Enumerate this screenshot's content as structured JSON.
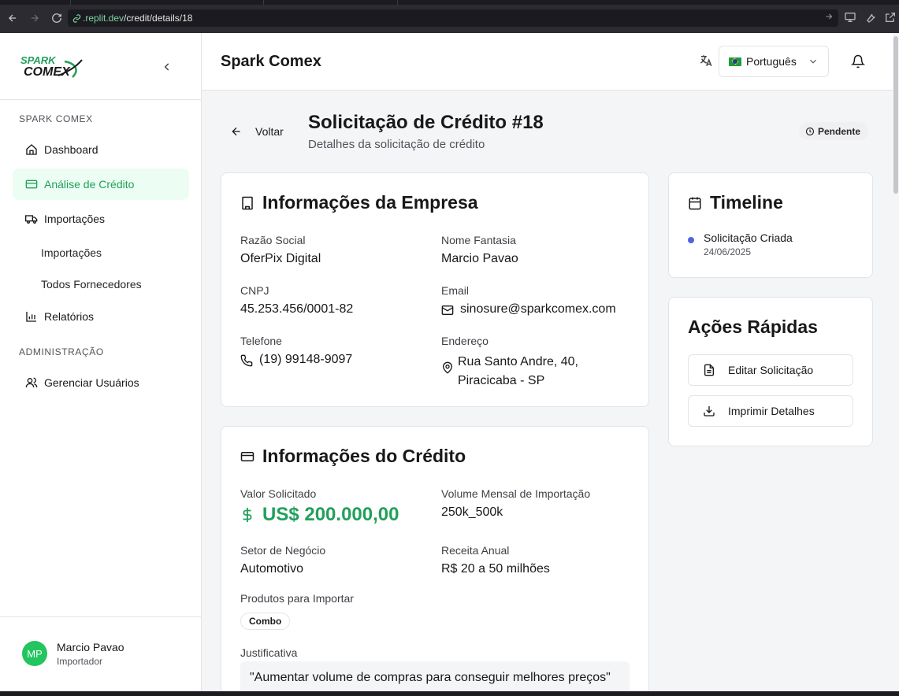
{
  "browser": {
    "url_domain": ".replit.dev",
    "url_path": "/credit/details/18"
  },
  "sidebar": {
    "logo_text_top": "SPARK",
    "logo_text_bottom": "COMEX",
    "section_main": "SPARK COMEX",
    "items": [
      {
        "label": "Dashboard",
        "icon": "home-icon"
      },
      {
        "label": "Análise de Crédito",
        "icon": "credit-card-icon",
        "active": true
      },
      {
        "label": "Importações",
        "icon": "truck-icon"
      },
      {
        "label": "Relatórios",
        "icon": "bar-chart-icon"
      }
    ],
    "subitems": [
      "Importações",
      "Todos Fornecedores"
    ],
    "section_admin": "ADMINISTRAÇÃO",
    "admin_items": [
      {
        "label": "Gerenciar Usuários",
        "icon": "users-icon"
      }
    ],
    "user": {
      "initials": "MP",
      "name": "Marcio Pavao",
      "role": "Importador"
    }
  },
  "header": {
    "title": "Spark Comex",
    "language": "Português"
  },
  "page": {
    "back_label": "Voltar",
    "title": "Solicitação de Crédito #18",
    "subtitle": "Detalhes da solicitação de crédito",
    "status": "Pendente"
  },
  "company": {
    "title": "Informações da Empresa",
    "razao_social_label": "Razão Social",
    "razao_social": "OferPix Digital",
    "nome_fantasia_label": "Nome Fantasia",
    "nome_fantasia": "Marcio Pavao",
    "cnpj_label": "CNPJ",
    "cnpj": "45.253.456/0001-82",
    "email_label": "Email",
    "email": "sinosure@sparkcomex.com",
    "telefone_label": "Telefone",
    "telefone": "(19) 99148-9097",
    "endereco_label": "Endereço",
    "endereco_line1": "Rua Santo Andre, 40,",
    "endereco_line2": "Piracicaba - SP"
  },
  "credit": {
    "title": "Informações do Crédito",
    "valor_label": "Valor Solicitado",
    "valor": "US$ 200.000,00",
    "volume_label": "Volume Mensal de Importação",
    "volume": "250k_500k",
    "setor_label": "Setor de Negócio",
    "setor": "Automotivo",
    "receita_label": "Receita Anual",
    "receita": "R$ 20 a 50 milhões",
    "produtos_label": "Produtos para Importar",
    "produtos": [
      "Combo"
    ],
    "justificativa_label": "Justificativa",
    "justificativa": "\"Aumentar volume de compras para conseguir melhores preços\""
  },
  "timeline": {
    "title": "Timeline",
    "events": [
      {
        "title": "Solicitação Criada",
        "date": "24/06/2025"
      }
    ]
  },
  "actions": {
    "title": "Ações Rápidas",
    "edit_label": "Editar Solicitação",
    "print_label": "Imprimir Detalhes"
  },
  "colors": {
    "accent": "#22a05a",
    "active_bg": "#ecfdf3",
    "timeline_dot": "#4f63e6"
  }
}
